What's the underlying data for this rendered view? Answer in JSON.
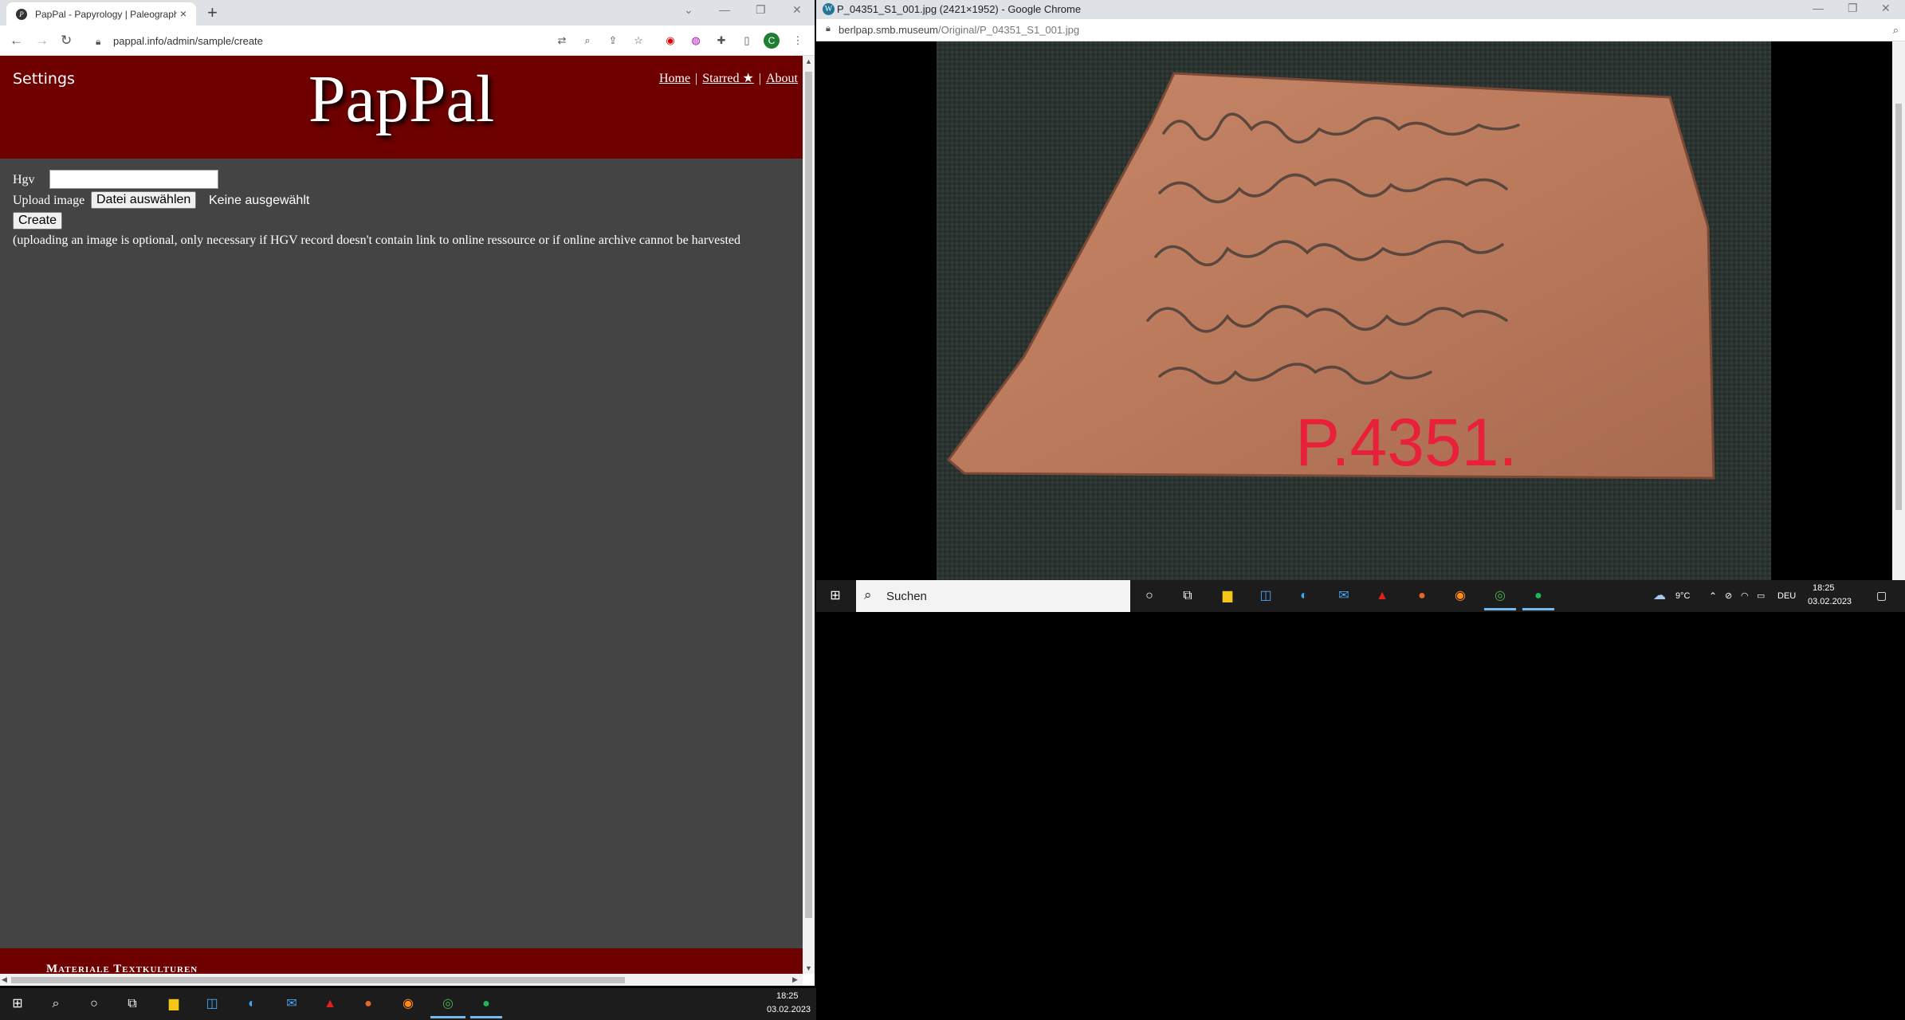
{
  "left_window": {
    "tab_title": "PapPal - Papyrology | Paleography",
    "tab_close": "×",
    "new_tab": "+",
    "win_controls": [
      "⌄",
      "—",
      "❐",
      "✕"
    ],
    "url": "pappal.info/admin/sample/create",
    "profile_initial": "C"
  },
  "site": {
    "settings": "Settings",
    "logo": "PapPal",
    "nav": {
      "home": "Home",
      "starred": "Starred ★",
      "about": "About",
      "sep": "|"
    },
    "form": {
      "hgv_label": "Hgv",
      "hgv_value": "",
      "upload_label": "Upload image",
      "choose_file": "Datei auswählen",
      "no_file": "Keine ausgewählt",
      "create": "Create",
      "note": "(uploading an image is optional, only necessary if HGV record doesn't contain link to online ressource or if online archive cannot be harvested"
    },
    "footer": "Materiale Textkulturen"
  },
  "right_window": {
    "title": "P_04351_S1_001.jpg (2421×1952) - Google Chrome",
    "url_host": "berlpap.smb.museum",
    "url_path": "/Original/P_04351_S1_001.jpg",
    "win_controls": [
      "—",
      "❐",
      "✕"
    ],
    "image_label": "P.4351."
  },
  "taskbar_small": {
    "search_text": "Suchen",
    "temperature": "9°C",
    "lang": "DEU",
    "time": "18:25",
    "date": "03.02.2023"
  },
  "taskbar_main": {
    "time": "18:25",
    "date": "03.02.2023"
  },
  "colors": {
    "header_bg": "#6e0000",
    "page_bg": "#444444",
    "taskbar_bg": "#1c1c1c"
  }
}
